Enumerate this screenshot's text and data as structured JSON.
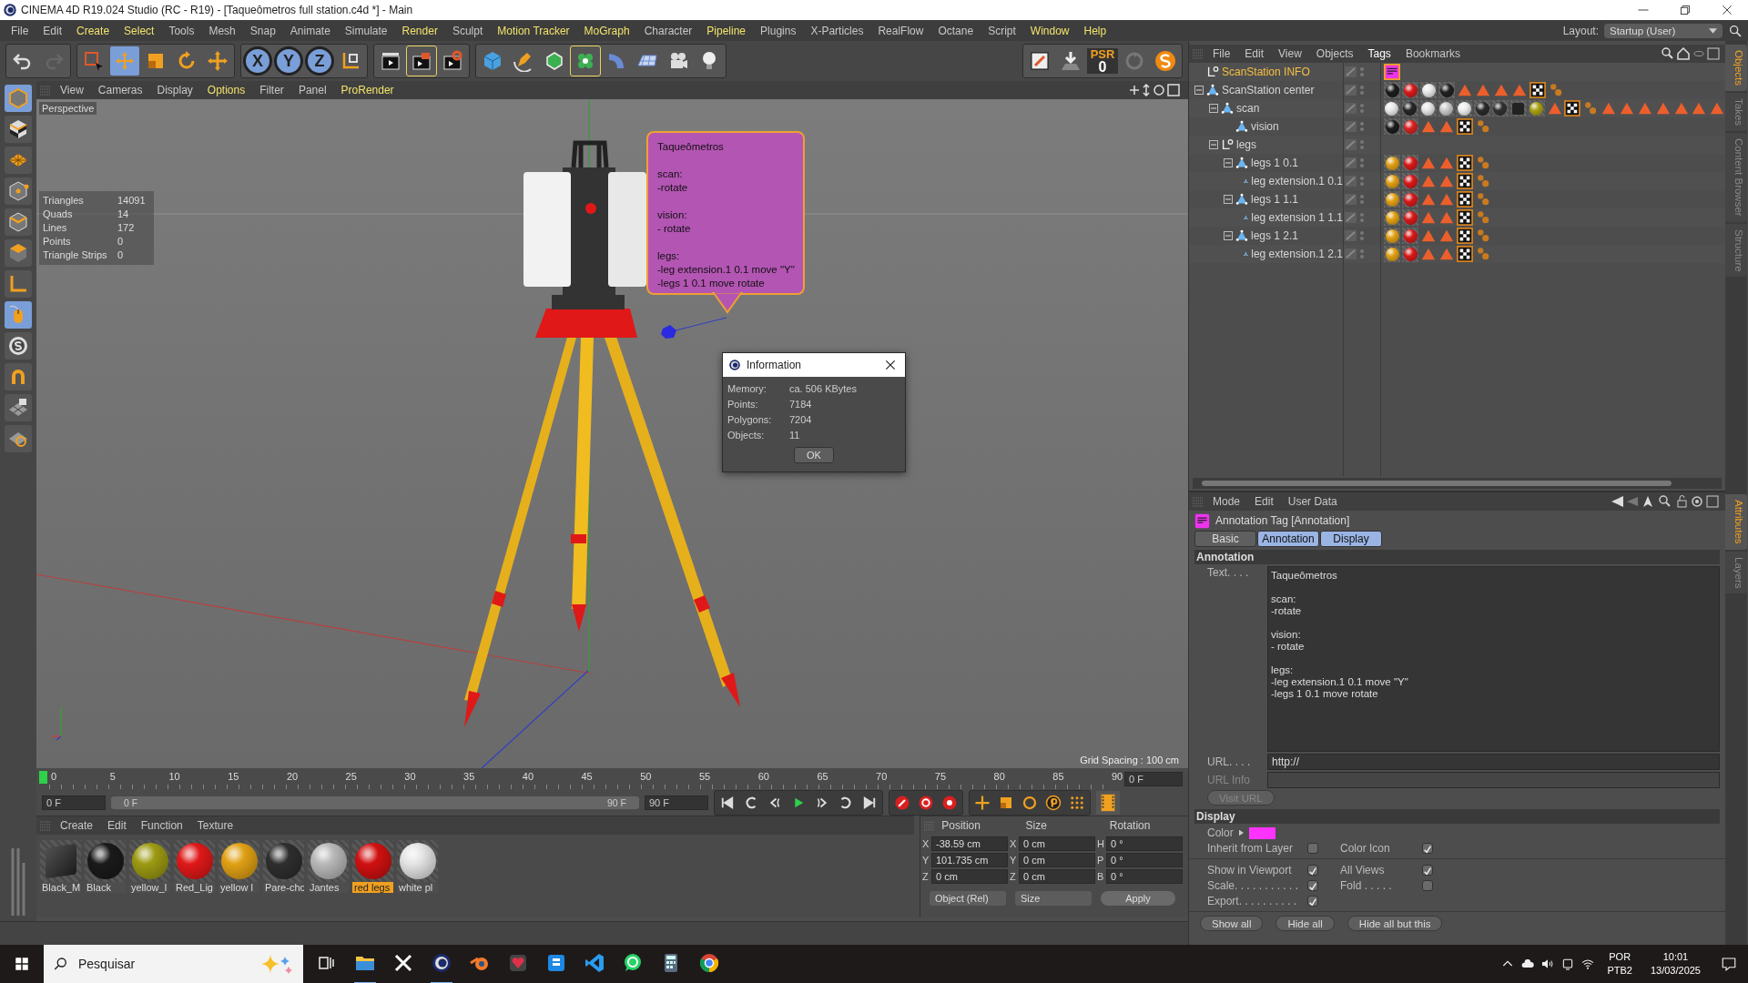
{
  "window": {
    "title": "CINEMA 4D R19.024 Studio (RC - R19) - [Taqueômetros full station.c4d *] - Main"
  },
  "menu_bar": [
    {
      "label": "File",
      "highlighted": false
    },
    {
      "label": "Edit",
      "highlighted": false
    },
    {
      "label": "Create",
      "highlighted": true
    },
    {
      "label": "Select",
      "highlighted": true
    },
    {
      "label": "Tools",
      "highlighted": false
    },
    {
      "label": "Mesh",
      "highlighted": false
    },
    {
      "label": "Snap",
      "highlighted": false
    },
    {
      "label": "Animate",
      "highlighted": false
    },
    {
      "label": "Simulate",
      "highlighted": false
    },
    {
      "label": "Render",
      "highlighted": true
    },
    {
      "label": "Sculpt",
      "highlighted": false
    },
    {
      "label": "Motion Tracker",
      "highlighted": true
    },
    {
      "label": "MoGraph",
      "highlighted": true
    },
    {
      "label": "Character",
      "highlighted": false
    },
    {
      "label": "Pipeline",
      "highlighted": true
    },
    {
      "label": "Plugins",
      "highlighted": false
    },
    {
      "label": "X-Particles",
      "highlighted": false
    },
    {
      "label": "RealFlow",
      "highlighted": false
    },
    {
      "label": "Octane",
      "highlighted": false
    },
    {
      "label": "Script",
      "highlighted": false
    },
    {
      "label": "Window",
      "highlighted": true
    },
    {
      "label": "Help",
      "highlighted": true
    }
  ],
  "layout": {
    "label": "Layout:",
    "value": "Startup (User)"
  },
  "toolbar": {
    "axis_locks": [
      {
        "label": "X",
        "on": true
      },
      {
        "label": "Y",
        "on": true
      },
      {
        "label": "Z",
        "on": true
      }
    ],
    "psr_label": "PSR",
    "psr_value": "0"
  },
  "viewport": {
    "menu": [
      {
        "label": "View",
        "highlighted": false
      },
      {
        "label": "Cameras",
        "highlighted": false
      },
      {
        "label": "Display",
        "highlighted": false
      },
      {
        "label": "Options",
        "highlighted": true
      },
      {
        "label": "Filter",
        "highlighted": false
      },
      {
        "label": "Panel",
        "highlighted": false
      },
      {
        "label": "ProRender",
        "highlighted": true
      }
    ],
    "view_name": "Perspective",
    "stats": [
      {
        "label": "Triangles",
        "value": "14091"
      },
      {
        "label": "Quads",
        "value": "14"
      },
      {
        "label": "Lines",
        "value": "172"
      },
      {
        "label": "Points",
        "value": "0"
      },
      {
        "label": "Triangle Strips",
        "value": "0"
      }
    ],
    "annotation": {
      "text": "Taqueômetros\n\nscan:\n-rotate\n\nvision:\n- rotate\n\nlegs:\n-leg extension.1 0.1 move \"Y\"\n-legs 1 0.1 move rotate"
    },
    "grid_spacing": "Grid Spacing : 100 cm"
  },
  "info_dialog": {
    "title": "Information",
    "rows": [
      {
        "label": "Memory:",
        "value": "ca. 506 KBytes"
      },
      {
        "label": "Points:",
        "value": "7184"
      },
      {
        "label": "Polygons:",
        "value": "7204"
      },
      {
        "label": "Objects:",
        "value": "11"
      }
    ],
    "ok_button": "OK"
  },
  "timeline": {
    "ticks": [
      "0",
      "5",
      "10",
      "15",
      "20",
      "25",
      "30",
      "35",
      "40",
      "45",
      "50",
      "55",
      "60",
      "65",
      "70",
      "75",
      "80",
      "85",
      "90"
    ],
    "current_frame": "0 F",
    "start_frame": "0 F",
    "range": {
      "start": "0 F",
      "end": "90 F",
      "level": 1
    },
    "end_frame": "90 F"
  },
  "materials": {
    "menu": [
      "Create",
      "Edit",
      "Function",
      "Texture"
    ],
    "items": [
      {
        "name": "Black_M",
        "kind": "cube",
        "color": "#262626",
        "selected": false
      },
      {
        "name": "Black",
        "kind": "sphere",
        "color": "#1a1a1a",
        "selected": false
      },
      {
        "name": "yellow_l",
        "kind": "sphere",
        "color": "#9c9a12",
        "selected": false
      },
      {
        "name": "Red_Lig",
        "kind": "sphere",
        "color": "#e01818",
        "selected": false
      },
      {
        "name": "yellow l",
        "kind": "sphere",
        "color": "#e0a014",
        "selected": false
      },
      {
        "name": "Pare-chc",
        "kind": "sphere",
        "color": "#2e2e2e",
        "selected": false
      },
      {
        "name": "Jantes",
        "kind": "sphere",
        "color": "#b8b8b8",
        "selected": false
      },
      {
        "name": "red legs",
        "kind": "sphere",
        "color": "#d01010",
        "selected": true
      },
      {
        "name": "white pl",
        "kind": "sphere",
        "color": "#e4e4e4",
        "selected": false
      }
    ]
  },
  "coordinates": {
    "headers": [
      "Position",
      "Size",
      "Rotation"
    ],
    "rows": [
      {
        "axis": "X",
        "position": "-38.59 cm",
        "size_axis": "X",
        "size": "0 cm",
        "rotation_axis": "H",
        "rotation": "0 °"
      },
      {
        "axis": "Y",
        "position": "101.735 cm",
        "size_axis": "Y",
        "size": "0 cm",
        "rotation_axis": "P",
        "rotation": "0 °"
      },
      {
        "axis": "Z",
        "position": "0 cm",
        "size_axis": "Z",
        "size": "0 cm",
        "rotation_axis": "B",
        "rotation": "0 °"
      }
    ],
    "mode": "Object (Rel)",
    "size_mode": "Size",
    "apply_button": "Apply"
  },
  "object_manager": {
    "menu": [
      {
        "label": "File",
        "highlighted": false
      },
      {
        "label": "Edit",
        "highlighted": false
      },
      {
        "label": "View",
        "highlighted": false
      },
      {
        "label": "Objects",
        "highlighted": false
      },
      {
        "label": "Tags",
        "highlighted": true
      },
      {
        "label": "Bookmarks",
        "highlighted": false
      }
    ],
    "tree": [
      {
        "name": "ScanStation INFO",
        "kind": "null",
        "selected": true,
        "tags": [
          {
            "kind": "annotation"
          }
        ]
      },
      {
        "name": "ScanStation center",
        "kind": "polygon",
        "selected": false,
        "expanded": true,
        "tags": [
          {
            "kind": "material",
            "color": "#1c1c1c"
          },
          {
            "kind": "material",
            "color": "#d81818"
          },
          {
            "kind": "material",
            "color": "#e8e8e8"
          },
          {
            "kind": "material",
            "color": "#202020"
          },
          {
            "kind": "selection"
          },
          {
            "kind": "selection"
          },
          {
            "kind": "selection"
          },
          {
            "kind": "selection"
          },
          {
            "kind": "uvw"
          },
          {
            "kind": "phong"
          }
        ],
        "children": [
          {
            "name": "scan",
            "kind": "polygon",
            "selected": false,
            "expanded": true,
            "tags": [
              {
                "kind": "material",
                "color": "#e8e8e8"
              },
              {
                "kind": "material",
                "color": "#262626"
              },
              {
                "kind": "material",
                "color": "#e4e4e4"
              },
              {
                "kind": "material",
                "color": "#c8c8c8"
              },
              {
                "kind": "material",
                "color": "#ececec"
              },
              {
                "kind": "material",
                "color": "#2a2a2a"
              },
              {
                "kind": "material",
                "color": "#303030"
              },
              {
                "kind": "material-cube",
                "color": "#222222"
              },
              {
                "kind": "material",
                "color": "#a8a012"
              },
              {
                "kind": "selection"
              },
              {
                "kind": "uvw"
              },
              {
                "kind": "phong"
              },
              {
                "kind": "selection"
              },
              {
                "kind": "selection"
              },
              {
                "kind": "selection"
              },
              {
                "kind": "selection"
              },
              {
                "kind": "selection"
              },
              {
                "kind": "selection"
              },
              {
                "kind": "selection"
              }
            ],
            "children": [
              {
                "name": "vision",
                "kind": "polygon",
                "selected": false,
                "tags": [
                  {
                    "kind": "material",
                    "color": "#1c1c1c"
                  },
                  {
                    "kind": "material",
                    "color": "#d82020"
                  },
                  {
                    "kind": "selection"
                  },
                  {
                    "kind": "selection"
                  },
                  {
                    "kind": "uvw"
                  },
                  {
                    "kind": "phong"
                  }
                ]
              }
            ]
          },
          {
            "name": "legs",
            "kind": "null",
            "selected": false,
            "expanded": true,
            "children": [
              {
                "name": "legs 1 0.1",
                "kind": "polygon",
                "selected": false,
                "expanded": true,
                "tags": [
                  {
                    "kind": "material",
                    "color": "#e0a014"
                  },
                  {
                    "kind": "material",
                    "color": "#d81818"
                  },
                  {
                    "kind": "selection"
                  },
                  {
                    "kind": "selection"
                  },
                  {
                    "kind": "uvw"
                  },
                  {
                    "kind": "phong"
                  }
                ],
                "children": [
                  {
                    "name": "leg extension.1 0.1",
                    "kind": "polygon",
                    "selected": false,
                    "tags": [
                      {
                        "kind": "material",
                        "color": "#e0a014"
                      },
                      {
                        "kind": "material",
                        "color": "#d81818"
                      },
                      {
                        "kind": "selection"
                      },
                      {
                        "kind": "selection"
                      },
                      {
                        "kind": "uvw"
                      },
                      {
                        "kind": "phong"
                      }
                    ]
                  }
                ]
              },
              {
                "name": "legs 1 1.1",
                "kind": "polygon",
                "selected": false,
                "expanded": true,
                "tags": [
                  {
                    "kind": "material",
                    "color": "#e0a014"
                  },
                  {
                    "kind": "material",
                    "color": "#d81818"
                  },
                  {
                    "kind": "selection"
                  },
                  {
                    "kind": "selection"
                  },
                  {
                    "kind": "uvw"
                  },
                  {
                    "kind": "phong"
                  }
                ],
                "children": [
                  {
                    "name": "leg extension 1 1.1",
                    "kind": "polygon",
                    "selected": false,
                    "tags": [
                      {
                        "kind": "material",
                        "color": "#e0a014"
                      },
                      {
                        "kind": "material",
                        "color": "#d81818"
                      },
                      {
                        "kind": "selection"
                      },
                      {
                        "kind": "selection"
                      },
                      {
                        "kind": "uvw"
                      },
                      {
                        "kind": "phong"
                      }
                    ]
                  }
                ]
              },
              {
                "name": "legs 1 2.1",
                "kind": "polygon",
                "selected": false,
                "expanded": true,
                "tags": [
                  {
                    "kind": "material",
                    "color": "#e0a014"
                  },
                  {
                    "kind": "material",
                    "color": "#d81818"
                  },
                  {
                    "kind": "selection"
                  },
                  {
                    "kind": "selection"
                  },
                  {
                    "kind": "uvw"
                  },
                  {
                    "kind": "phong"
                  }
                ],
                "children": [
                  {
                    "name": "leg extension.1 2.1",
                    "kind": "polygon",
                    "selected": false,
                    "tags": [
                      {
                        "kind": "material",
                        "color": "#e0a014"
                      },
                      {
                        "kind": "material",
                        "color": "#d81818"
                      },
                      {
                        "kind": "selection"
                      },
                      {
                        "kind": "selection"
                      },
                      {
                        "kind": "uvw"
                      },
                      {
                        "kind": "phong"
                      }
                    ]
                  }
                ]
              }
            ]
          }
        ]
      }
    ]
  },
  "side_tabs_top": [
    {
      "label": "Objects",
      "selected": true
    },
    {
      "label": "Takes",
      "selected": false
    },
    {
      "label": "Content Browser",
      "selected": false
    },
    {
      "label": "Structure",
      "selected": false
    }
  ],
  "side_tabs_bottom": [
    {
      "label": "Attributes",
      "selected": true
    },
    {
      "label": "Layers",
      "selected": false
    }
  ],
  "attributes": {
    "menu": [
      "Mode",
      "Edit",
      "User Data"
    ],
    "title": "Annotation Tag [Annotation]",
    "tabs": [
      {
        "label": "Basic",
        "selected": false
      },
      {
        "label": "Annotation",
        "selected": true
      },
      {
        "label": "Display",
        "selected": true
      }
    ],
    "annotation_section": "Annotation",
    "text_label": "Text. . . .",
    "text": "Taqueômetros\n\nscan:\n-rotate\n\nvision:\n- rotate\n\nlegs:\n-leg extension.1 0.1 move \"Y\"\n-legs 1 0.1 move rotate",
    "url_label": "URL. . . .",
    "url": "http://",
    "url_info": {
      "label": "URL Info",
      "disabled": true
    },
    "visit_url": {
      "label": "Visit URL",
      "disabled": true
    },
    "display_section": "Display",
    "color_label": "Color",
    "color": "#ff33ff",
    "checks": [
      {
        "label": "Inherit from Layer",
        "checked": false
      },
      {
        "label": "Color Icon",
        "checked": true
      },
      {
        "label": "Show in Viewport",
        "checked": true
      },
      {
        "label": "All Views",
        "checked": true
      },
      {
        "label": "Scale. . . . . . . . . . .",
        "checked": true
      },
      {
        "label": "Fold . . . . .",
        "checked": false
      },
      {
        "label": "Export. . . . . . . . . .",
        "checked": true
      }
    ],
    "buttons": [
      "Show all",
      "Hide all",
      "Hide all but this"
    ]
  },
  "taskbar": {
    "search_placeholder": "Pesquisar",
    "language": "POR",
    "keyboard": "PTB2",
    "time": "10:01",
    "date": "13/03/2025"
  }
}
